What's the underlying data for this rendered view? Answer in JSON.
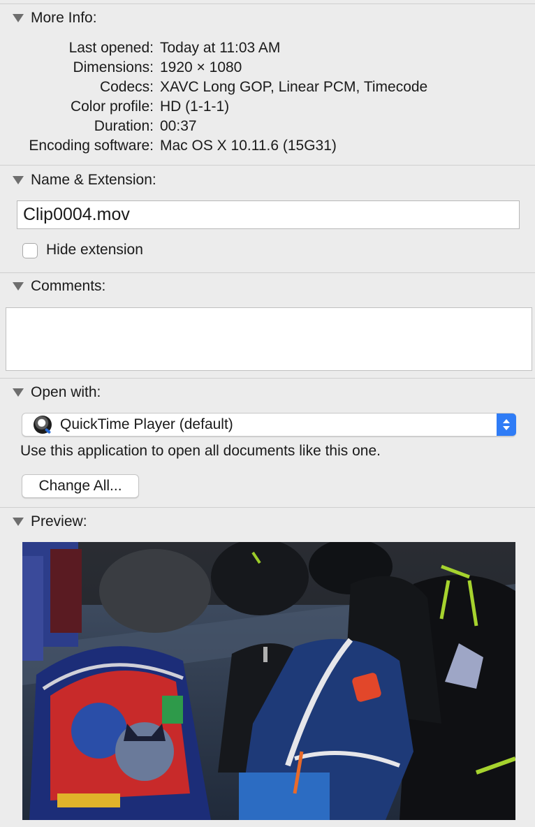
{
  "more_info": {
    "title": "More Info:",
    "rows": [
      {
        "key": "Last opened:",
        "value": "Today at 11:03 AM"
      },
      {
        "key": "Dimensions:",
        "value": "1920 × 1080"
      },
      {
        "key": "Codecs:",
        "value": "XAVC Long GOP, Linear PCM, Timecode"
      },
      {
        "key": "Color profile:",
        "value": "HD (1-1-1)"
      },
      {
        "key": "Duration:",
        "value": "00:37"
      },
      {
        "key": "Encoding software:",
        "value": "Mac OS X 10.11.6 (15G31)"
      }
    ]
  },
  "name_extension": {
    "title": "Name & Extension:",
    "filename": "Clip0004.mov",
    "hide_extension_label": "Hide extension",
    "hide_extension_checked": false
  },
  "comments": {
    "title": "Comments:",
    "value": ""
  },
  "open_with": {
    "title": "Open with:",
    "app": "QuickTime Player (default)",
    "app_icon": "quicktime-icon",
    "help_text": "Use this application to open all documents like this one.",
    "change_all_label": "Change All..."
  },
  "preview": {
    "title": "Preview:",
    "image_description": "video frame of children's backpacks on a blue bench"
  },
  "colors": {
    "background": "#ececec",
    "accent": "#2f7cf6",
    "disclosure": "#6e6e6e"
  }
}
